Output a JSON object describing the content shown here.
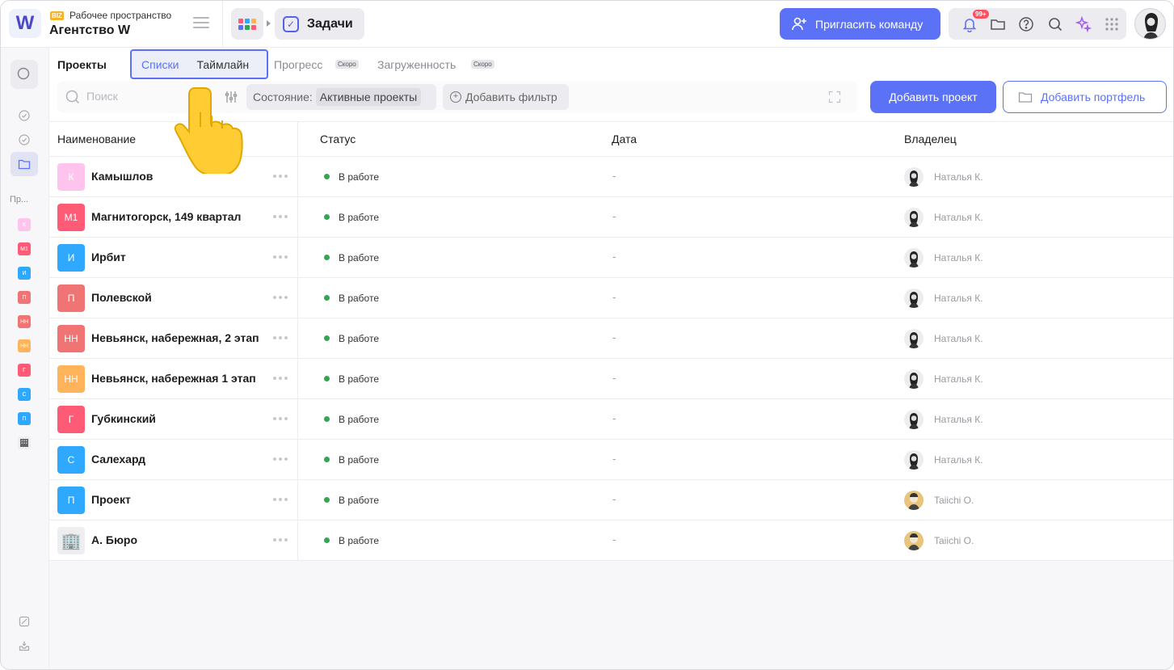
{
  "workspace": {
    "badge": "BIZ",
    "label": "Рабочее пространство",
    "name": "Агентство W",
    "logo": "W"
  },
  "header": {
    "section": "Задачи",
    "invite_label": "Пригласить команду",
    "notifications_count": "99+",
    "icons": [
      "bell-icon",
      "folder-icon",
      "help-icon",
      "search-icon",
      "sparkle-icon",
      "grid-icon"
    ]
  },
  "rail": {
    "projects_label": "Пр...",
    "projects": [
      "К",
      "М1",
      "И",
      "П",
      "НН",
      "НН",
      "Г",
      "С",
      "П"
    ]
  },
  "toolbar": {
    "title": "Проекты",
    "tabs": {
      "lists": "Списки",
      "timeline": "Таймлайн",
      "progress": "Прогресс",
      "load": "Загруженность",
      "soon": "Скоро"
    },
    "search_placeholder": "Поиск",
    "state_label": "Состояние:",
    "state_value": "Активные проекты",
    "add_filter": "Добавить фильтр",
    "add_project": "Добавить проект",
    "add_portfolio": "Добавить портфель"
  },
  "table": {
    "columns": [
      "Наименование",
      "Статус",
      "Дата",
      "Владелец"
    ],
    "rows": [
      {
        "badge": "К",
        "color": "#ffc4ee",
        "name": "Камышлов",
        "status": "В работе",
        "date": "-",
        "owner": "Наталья К."
      },
      {
        "badge": "М1",
        "color": "#ff5a76",
        "name": "Магнитогорск, 149 квартал",
        "status": "В работе",
        "date": "-",
        "owner": "Наталья К."
      },
      {
        "badge": "И",
        "color": "#2fa8ff",
        "name": "Ирбит",
        "status": "В работе",
        "date": "-",
        "owner": "Наталья К."
      },
      {
        "badge": "П",
        "color": "#f07474",
        "name": "Полевской",
        "status": "В работе",
        "date": "-",
        "owner": "Наталья К."
      },
      {
        "badge": "НН",
        "color": "#f07474",
        "name": "Невьянск, набережная, 2 этап",
        "status": "В работе",
        "date": "-",
        "owner": "Наталья К."
      },
      {
        "badge": "НН",
        "color": "#ffb45c",
        "name": "Невьянск, набережная 1 этап",
        "status": "В работе",
        "date": "-",
        "owner": "Наталья К."
      },
      {
        "badge": "Г",
        "color": "#ff5a76",
        "name": "Губкинский",
        "status": "В работе",
        "date": "-",
        "owner": "Наталья К."
      },
      {
        "badge": "С",
        "color": "#2fa8ff",
        "name": "Салехард",
        "status": "В работе",
        "date": "-",
        "owner": "Наталья К."
      },
      {
        "badge": "П",
        "color": "#2fa8ff",
        "name": "Проект",
        "status": "В работе",
        "date": "-",
        "owner": "Taiichi O."
      },
      {
        "badge": "🏢",
        "color": "#eeeef1",
        "name": "А. Бюро",
        "status": "В работе",
        "date": "-",
        "owner": "Taiichi O."
      }
    ]
  },
  "colors": {
    "accent": "#5b72f6",
    "status_active": "#2fa84f"
  }
}
